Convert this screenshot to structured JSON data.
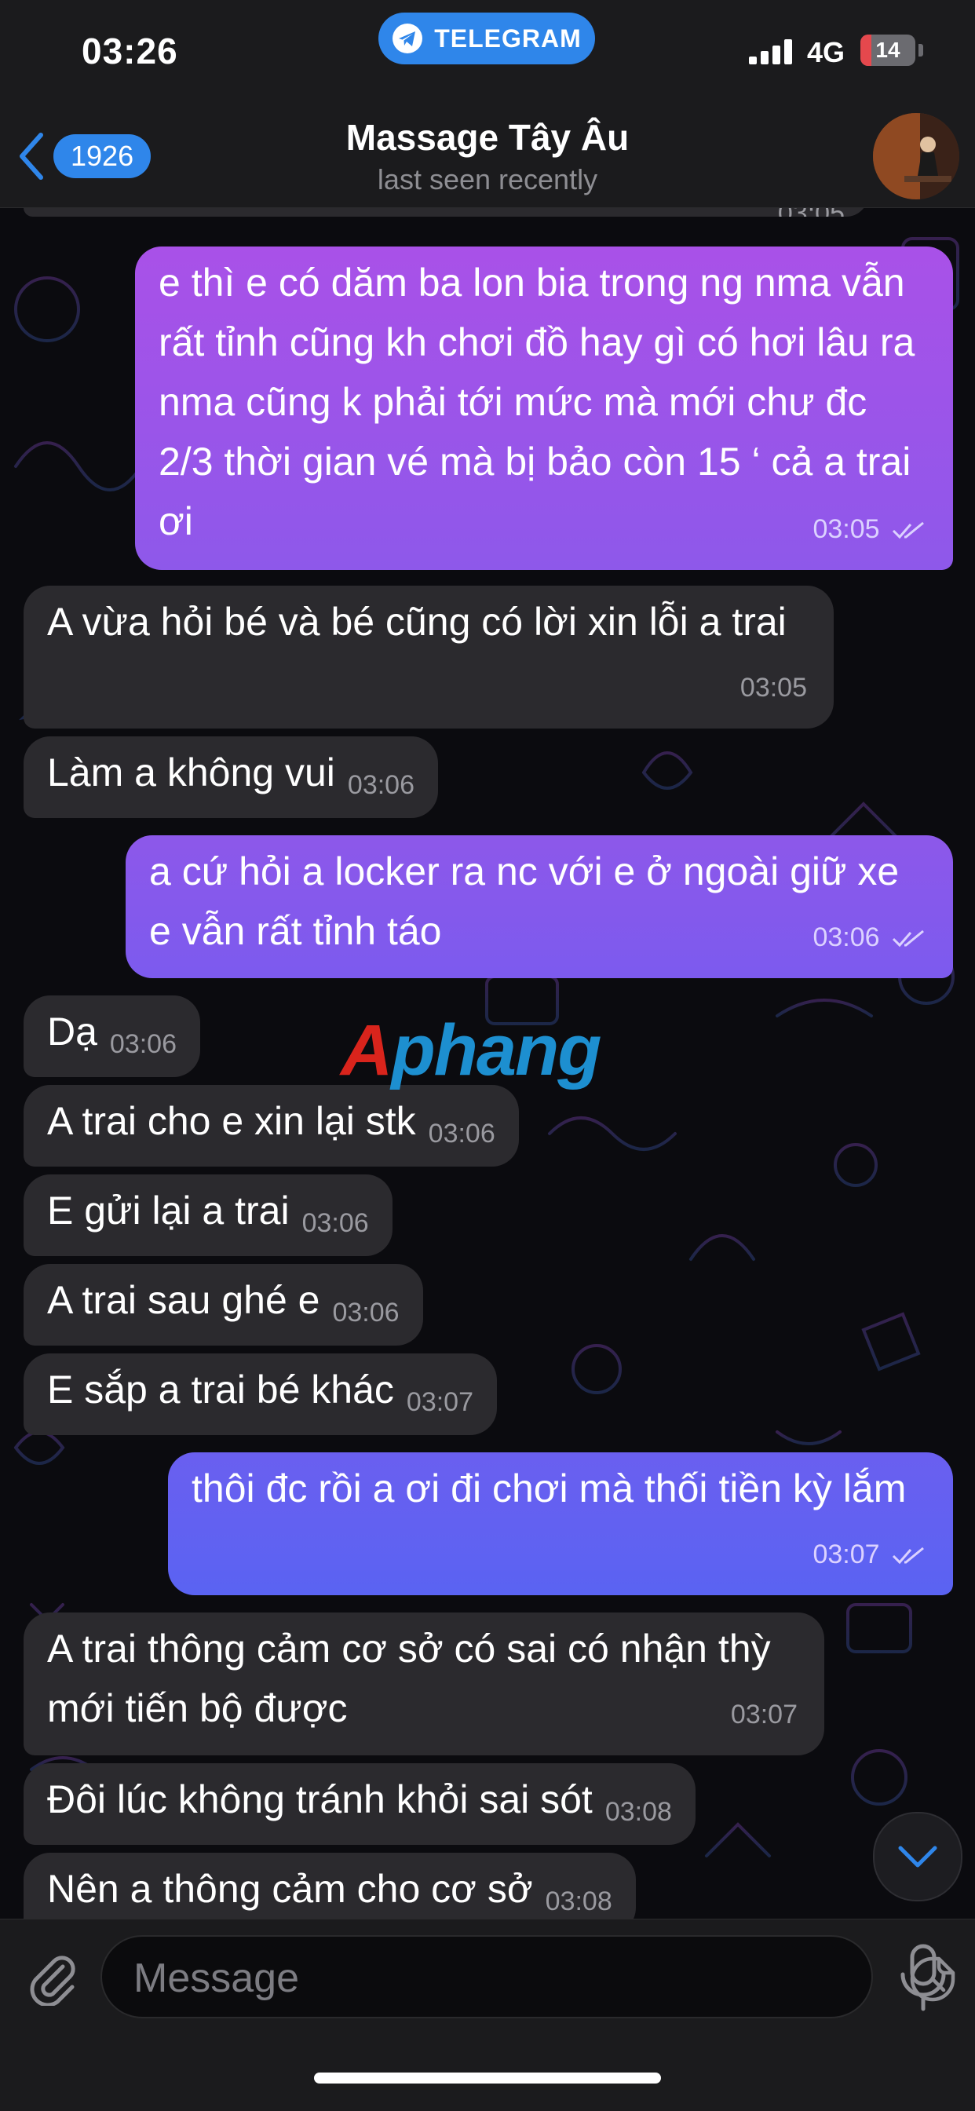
{
  "status_bar": {
    "time": "03:26",
    "app_pill": "TELEGRAM",
    "network": "4G",
    "battery": "14"
  },
  "header": {
    "back_count": "1926",
    "title": "Massage Tây Âu",
    "subtitle": "last seen recently"
  },
  "messages": [
    {
      "dir": "out",
      "text": "e thì e có dăm ba lon bia trong ng nma vẫn rất tỉnh cũng kh chơi đồ hay gì có hơi lâu ra nma cũng k phải tới mức mà mới chư đc 2/3 thời gian vé mà bị bảo còn 15 ‘ cả a trai ơi",
      "time": "03:05"
    },
    {
      "dir": "in",
      "text": "A vừa hỏi bé và bé cũng có lời xin lỗi a trai",
      "time": "03:05"
    },
    {
      "dir": "in",
      "text": "Làm a không vui",
      "time": "03:06"
    },
    {
      "dir": "out",
      "text": "a cứ hỏi a locker ra nc với e ở ngoài giữ xe e vẫn rất tỉnh táo",
      "time": "03:06"
    },
    {
      "dir": "in",
      "text": "Dạ",
      "time": "03:06"
    },
    {
      "dir": "in",
      "text": "A trai cho e xin lại stk",
      "time": "03:06"
    },
    {
      "dir": "in",
      "text": "E gửi lại a trai",
      "time": "03:06"
    },
    {
      "dir": "in",
      "text": "A trai sau ghé e",
      "time": "03:06"
    },
    {
      "dir": "in",
      "text": "E sắp a trai bé khác",
      "time": "03:07"
    },
    {
      "dir": "out",
      "text": "thôi đc rồi a ơi đi chơi mà thối tiền kỳ lắm",
      "time": "03:07"
    },
    {
      "dir": "in",
      "text": "A trai thông cảm cơ sở có sai có nhận thỳ mới tiến bộ được",
      "time": "03:07"
    },
    {
      "dir": "in",
      "text": "Đôi lúc không tránh khỏi sai sót",
      "time": "03:08"
    },
    {
      "dir": "in",
      "text": "Nên a thông cảm cho cơ sở",
      "time": "03:08"
    }
  ],
  "partial_top_time": "03:05",
  "watermark": {
    "first": "A",
    "rest": "phang"
  },
  "input": {
    "placeholder": "Message"
  },
  "colors": {
    "accent": "#2f86ea",
    "incoming_bubble": "#2b2a2e",
    "outgoing_gradient_top": "#a651ea",
    "outgoing_gradient_bottom": "#5a63f0"
  },
  "icons": [
    "telegram-icon",
    "back-chevron-icon",
    "paperclip-icon",
    "sticker-icon",
    "microphone-icon",
    "chevron-down-icon",
    "double-check-icon"
  ]
}
